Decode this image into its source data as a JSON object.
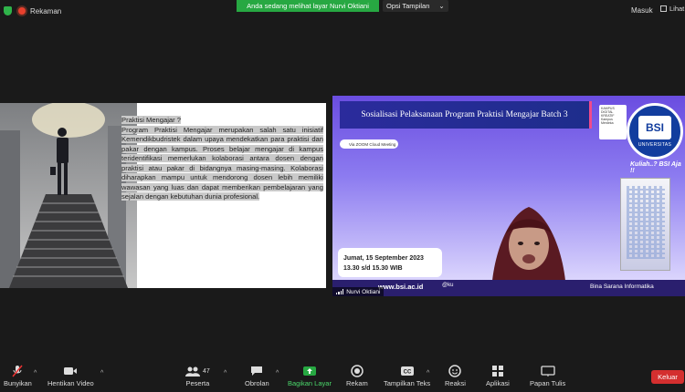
{
  "topbar": {
    "recording_label": "Rekaman",
    "viewing_banner": "Anda sedang melihat layar Nurvi Oktiani",
    "view_options": "Opsi Tampilan",
    "sign_in": "Masuk",
    "view_label": "Lihat"
  },
  "slide_left": {
    "heading": "Praktisi Mengajar ?",
    "body": "Program Praktisi Mengajar merupakan salah satu inisiatif Kemendikbudristek dalam upaya mendekatkan para praktisi dan pakar dengan kampus. Proses belajar mengajar di kampus teridentifikasi memerlukan kolaborasi antara dosen dengan praktisi atau pakar di bidangnya masing-masing. Kolaborasi diharapkan mampu untuk mendorong dosen lebih memiliki wawasan yang luas dan dapat memberikan pembelajaran yang sejalan dengan kebutuhan dunia profesional."
  },
  "slide_right": {
    "banner": "Sosialisasi Pelaksanaan Program Praktisi Mengajar Batch 3",
    "kampus_logo": "KAMPUS DIGITAL KREATIF Kampus Merdeka",
    "univ_mark": "BSI",
    "univ_name": "UNIVERSITAS",
    "tagline": "Kuliah..? BSI Aja !!",
    "zoom_pill": "Via ZOOM Cloud Meeting",
    "date_line1": "Jumat, 15 September 2023",
    "date_line2": "13.30 s/d 15.30 WIB",
    "url": "www.bsi.ac.id",
    "social": "@ku",
    "brand_footer": "Bina Sarana Informatika",
    "participant_name": "Nurvi Oktiani"
  },
  "toolbar": {
    "mute": "Bunyikan",
    "stop_video": "Hentikan Video",
    "participants": "Peserta",
    "participants_count": "47",
    "chat": "Obrolan",
    "share_screen": "Bagikan Layar",
    "record": "Rekam",
    "captions": "Tampilkan Teks",
    "reactions": "Reaksi",
    "apps": "Aplikasi",
    "whiteboard": "Papan Tulis",
    "leave": "Keluar"
  },
  "colors": {
    "accent_green": "#27a842",
    "leave_red": "#d42f2f",
    "slide_purple": "#6a4de0"
  }
}
